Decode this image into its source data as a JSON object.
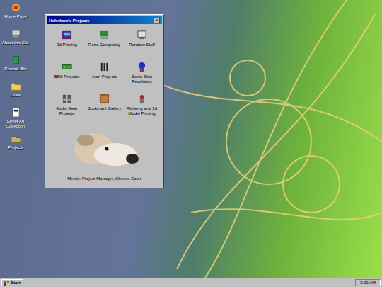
{
  "desktop_icons": [
    {
      "label": "Home Page"
    },
    {
      "label": "About this Site"
    },
    {
      "label": "Remote Bin"
    },
    {
      "label": "Links"
    },
    {
      "label": "Street Art Collection"
    },
    {
      "label": "Projects"
    }
  ],
  "window": {
    "title": "Hohokam's Projects",
    "close": "×",
    "items": [
      {
        "label": "3d Printing"
      },
      {
        "label": "Retro Computing"
      },
      {
        "label": "Random Stuff"
      },
      {
        "label": "BBS Projects"
      },
      {
        "label": "Atari Projects"
      },
      {
        "label": "Sonic Shot Revolution"
      },
      {
        "label": "Audio Gear Projects"
      },
      {
        "label": "Bookmark Gallery"
      },
      {
        "label": "Alchemy and 3d Model Printing"
      }
    ],
    "photo_caption": "Melvin: Project Manager, Cheese Eater"
  },
  "taskbar": {
    "start": "Start",
    "clock": "3:29 AM"
  }
}
